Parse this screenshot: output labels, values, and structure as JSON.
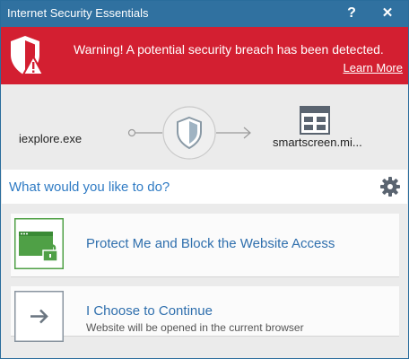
{
  "window": {
    "title": "Internet Security Essentials",
    "help_label": "?",
    "close_label": "✕"
  },
  "banner": {
    "message": "Warning! A potential security breach has been detected.",
    "learn_more": "Learn More"
  },
  "flow": {
    "source": "iexplore.exe",
    "destination": "smartscreen.mi..."
  },
  "prompt": {
    "question": "What would you like to do?"
  },
  "options": [
    {
      "label": "Protect Me and Block the Website Access"
    },
    {
      "label": "I Choose to Continue",
      "sublabel": "Website will be opened in the current browser"
    }
  ],
  "colors": {
    "titlebar": "#3071a0",
    "banner": "#d31f31",
    "accent_blue": "#2f7bc4",
    "protect_green": "#4fa046"
  },
  "icons": {
    "banner": "shield-warning-icon",
    "flow_center": "shield-icon",
    "destination": "webpage-icon",
    "settings": "gear-icon",
    "protect": "locked-browser-icon",
    "continue": "arrow-right-icon"
  }
}
